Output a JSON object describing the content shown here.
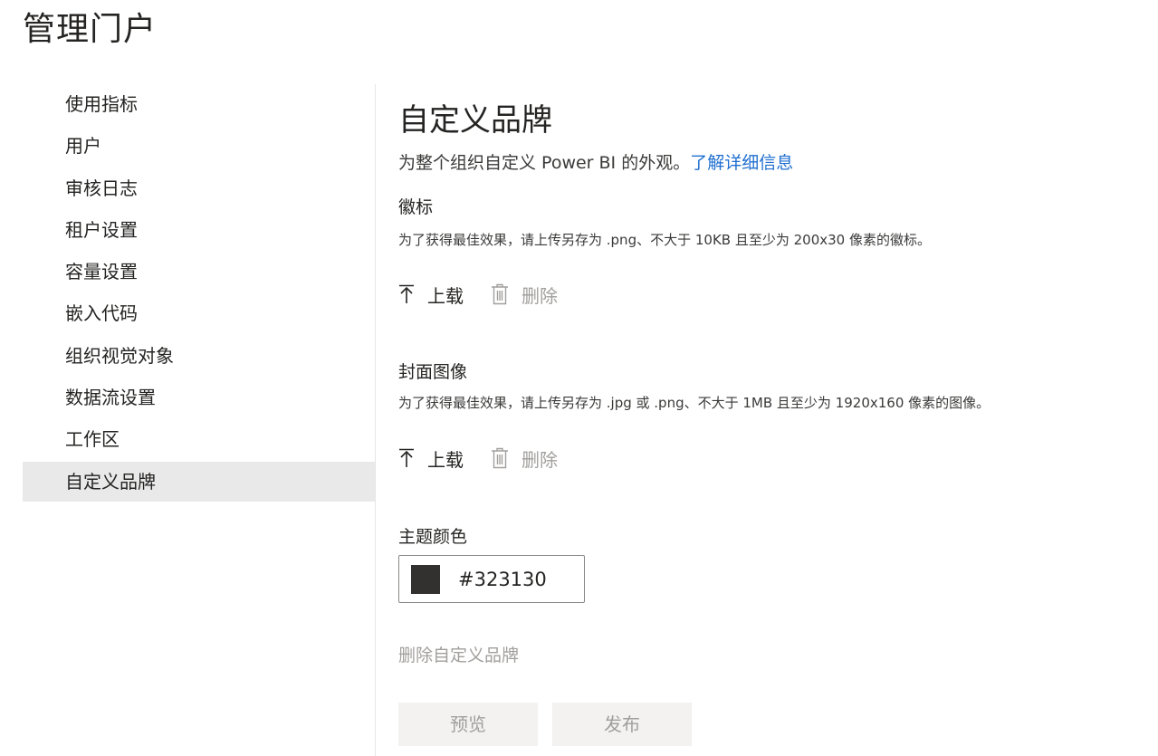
{
  "portal": {
    "title": "管理门户"
  },
  "sidebar": {
    "items": [
      {
        "label": "使用指标"
      },
      {
        "label": "用户"
      },
      {
        "label": "审核日志"
      },
      {
        "label": "租户设置"
      },
      {
        "label": "容量设置"
      },
      {
        "label": "嵌入代码"
      },
      {
        "label": "组织视觉对象"
      },
      {
        "label": "数据流设置"
      },
      {
        "label": "工作区"
      },
      {
        "label": "自定义品牌"
      }
    ],
    "active_index": 9
  },
  "main": {
    "title": "自定义品牌",
    "subtitle": "为整个组织自定义 Power BI 的外观。",
    "learn_more": "了解详细信息",
    "logo": {
      "heading": "徽标",
      "description": "为了获得最佳效果，请上传另存为 .png、不大于 10KB 且至少为 200x30 像素的徽标。",
      "upload_label": "上载",
      "delete_label": "删除"
    },
    "cover": {
      "heading": "封面图像",
      "description": "为了获得最佳效果，请上传另存为 .jpg 或 .png、不大于 1MB 且至少为 1920x160 像素的图像。",
      "upload_label": "上载",
      "delete_label": "删除"
    },
    "theme": {
      "heading": "主题颜色",
      "color_value": "#323130",
      "swatch_color": "#323130"
    },
    "remove_branding": "删除自定义品牌",
    "buttons": {
      "preview": "预览",
      "publish": "发布"
    }
  },
  "colors": {
    "link": "#1f6fd0",
    "active_nav_bg": "#e9e9e9",
    "disabled_text": "#a19f9d",
    "disabled_button_bg": "#f3f2f1"
  }
}
